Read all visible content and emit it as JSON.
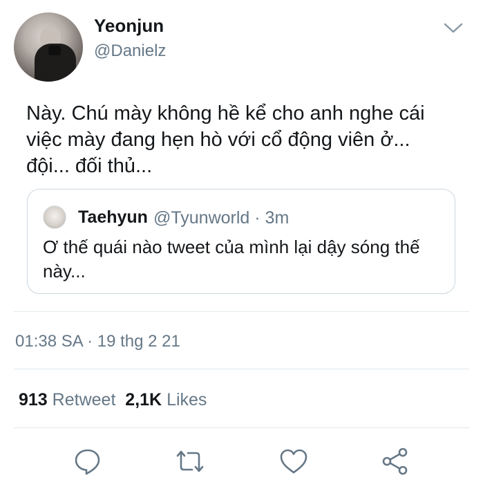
{
  "author": {
    "name": "Yeonjun",
    "handle": "@Danielz"
  },
  "tweet": {
    "text_lines": [
      "Này. Chú mày không hề kể cho anh nghe cái",
      "việc mày đang hẹn hò với cổ động viên ở...",
      "đội... đối thủ..."
    ]
  },
  "quoted": {
    "name": "Taehyun",
    "meta": "@Tyunworld · 3m",
    "text_lines": [
      "Ơ thế quái nào tweet của mình lại dậy sóng thế",
      "này..."
    ]
  },
  "timestamp": "01:38 SA · 19 thg 2 21",
  "stats": {
    "retweets_count": "913",
    "retweets_label": "Retweet",
    "likes_count": "2,1K",
    "likes_label": "Likes"
  },
  "icons": {
    "menu": "chevron-down-icon",
    "reply": "reply-icon",
    "retweet": "retweet-icon",
    "like": "heart-icon",
    "share": "share-icon"
  },
  "colors": {
    "text": "#14171a",
    "secondary": "#657786",
    "border": "#ccd6dd",
    "divider": "#e1e8ed"
  }
}
